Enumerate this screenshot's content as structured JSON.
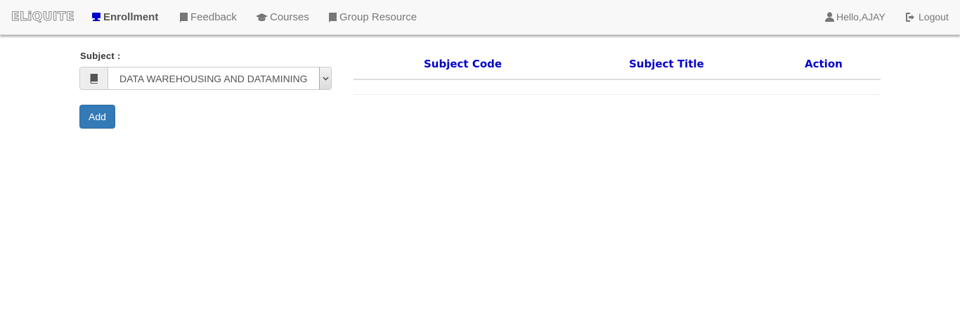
{
  "navbar": {
    "brand": "ELiQUITE",
    "items": [
      {
        "label": "Enrollment",
        "icon": "monitor-icon",
        "active": true
      },
      {
        "label": "Feedback",
        "icon": "book-icon",
        "active": false
      },
      {
        "label": "Courses",
        "icon": "graduation-cap-icon",
        "active": false
      },
      {
        "label": "Group Resource",
        "icon": "book-icon",
        "active": false
      }
    ],
    "user_greeting": "Hello,AJAY",
    "logout_label": "Logout"
  },
  "form": {
    "subject_label": "Subject :",
    "subject_selected": "DATA WAREHOUSING AND DATAMINING",
    "add_label": "Add"
  },
  "table": {
    "columns": [
      "Subject Code",
      "Subject Title",
      "Action"
    ],
    "rows": []
  },
  "colors": {
    "accent_blue": "#0000cc",
    "button_primary": "#337ab7",
    "navbar_bg": "#f8f8f8"
  }
}
